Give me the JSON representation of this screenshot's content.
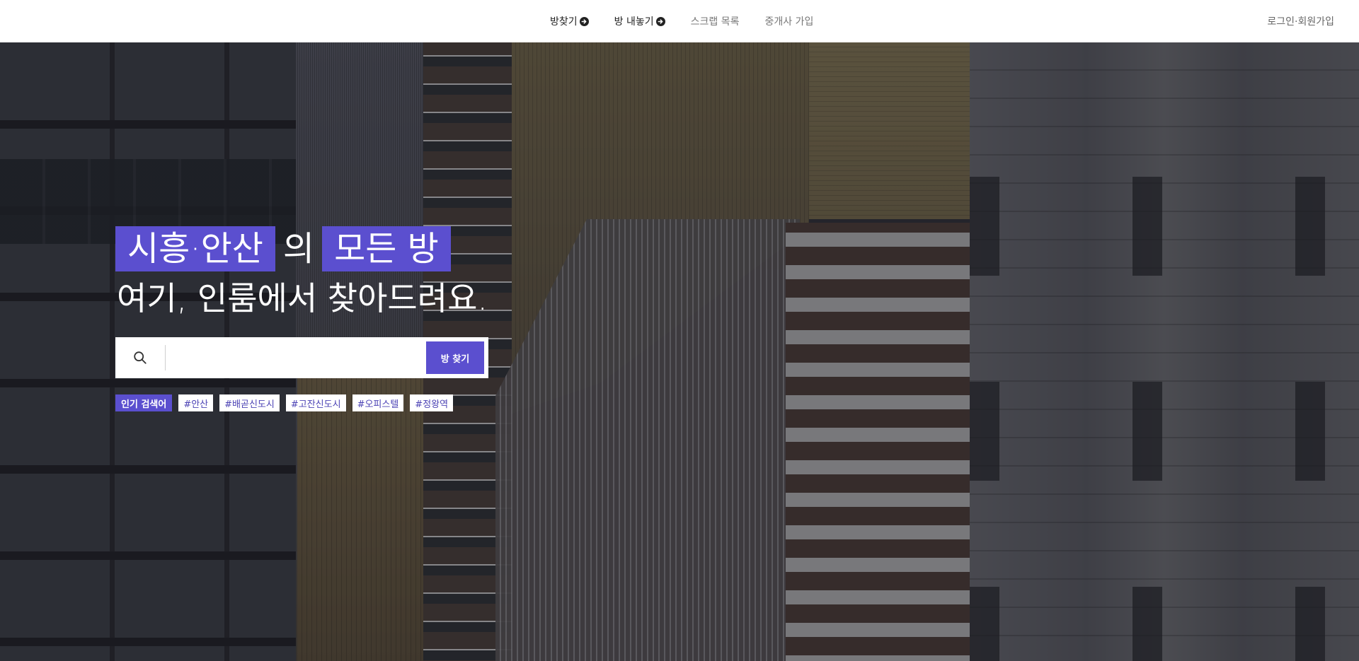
{
  "header": {
    "nav": [
      {
        "label": "방찾기",
        "primary": true,
        "arrow_icon": "arrow-circle-right-icon"
      },
      {
        "label": "방 내놓기",
        "primary": true,
        "arrow_icon": "arrow-circle-right-icon"
      },
      {
        "label": "스크랩 목록",
        "primary": false
      },
      {
        "label": "중개사 가입",
        "primary": false
      }
    ],
    "login_label": "로그인·회원가입"
  },
  "hero": {
    "headline": {
      "region": "시흥·안산",
      "particle": "의",
      "highlight": "모든 방",
      "line2": "여기, 인룸에서 찾아드려요."
    },
    "search": {
      "icon": "search-icon",
      "placeholder": "",
      "value": "",
      "button_label": "방 찾기"
    },
    "popular": {
      "label": "인기 검색어",
      "tags": [
        "#안산",
        "#배곧신도시",
        "#고잔신도시",
        "#오피스텔",
        "#정왕역"
      ]
    }
  },
  "colors": {
    "accent": "#5b4fcf",
    "header_bg": "#ffffff",
    "nav_active": "#222222",
    "nav_inactive": "#777777"
  }
}
